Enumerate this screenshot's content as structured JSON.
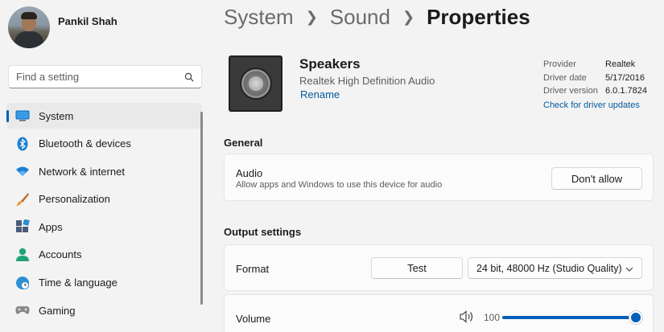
{
  "profile": {
    "name": "Pankil Shah"
  },
  "search": {
    "placeholder": "Find a setting"
  },
  "nav": {
    "items": [
      {
        "label": "System",
        "icon": "system-icon",
        "color": "#0078d4",
        "active": true
      },
      {
        "label": "Bluetooth & devices",
        "icon": "bluetooth-icon",
        "color": "#0078d4"
      },
      {
        "label": "Network & internet",
        "icon": "wifi-icon",
        "color": "#0078d4"
      },
      {
        "label": "Personalization",
        "icon": "brush-icon",
        "color": "#c46a2a"
      },
      {
        "label": "Apps",
        "icon": "apps-icon",
        "color": "#4a5a78"
      },
      {
        "label": "Accounts",
        "icon": "person-icon",
        "color": "#20a27a"
      },
      {
        "label": "Time & language",
        "icon": "globe-clock-icon",
        "color": "#2d8fd6"
      },
      {
        "label": "Gaming",
        "icon": "gamepad-icon",
        "color": "#6b6b6b"
      }
    ]
  },
  "breadcrumb": {
    "first": "System",
    "second": "Sound",
    "current": "Properties"
  },
  "device": {
    "name": "Speakers",
    "subtitle": "Realtek High Definition Audio",
    "rename": "Rename"
  },
  "driver": {
    "provider_key": "Provider",
    "provider_val": "Realtek",
    "date_key": "Driver date",
    "date_val": "5/17/2016",
    "version_key": "Driver version",
    "version_val": "6.0.1.7824",
    "update_link": "Check for driver updates"
  },
  "general": {
    "title": "General",
    "audio_title": "Audio",
    "audio_desc": "Allow apps and Windows to use this device for audio",
    "allow_button": "Don't allow"
  },
  "output": {
    "title": "Output settings",
    "format_label": "Format",
    "test_button": "Test",
    "format_value": "24 bit, 48000 Hz (Studio Quality)",
    "volume_label": "Volume",
    "volume_value": "100",
    "volume_level": 1.0
  },
  "colors": {
    "accent": "#005fb8",
    "link": "#005a9e"
  }
}
